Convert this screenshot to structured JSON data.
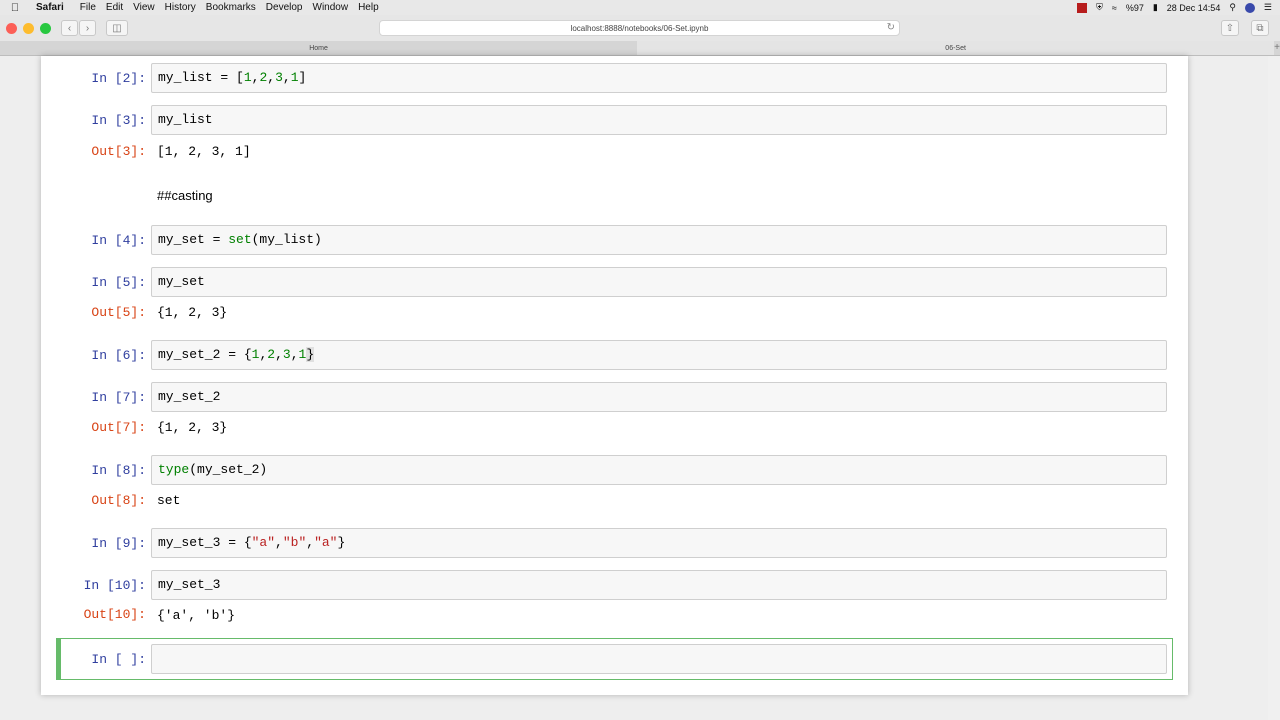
{
  "menubar": {
    "app": "Safari",
    "items": [
      "File",
      "Edit",
      "View",
      "History",
      "Bookmarks",
      "Develop",
      "Window",
      "Help"
    ],
    "battery": "%97",
    "datetime": "28 Dec  14:54"
  },
  "browser": {
    "url": "localhost:8888/notebooks/06-Set.ipynb",
    "tabs": [
      "Home",
      "06-Set"
    ]
  },
  "notebook": {
    "cells": [
      {
        "prompt": "In [2]:",
        "code": "my_list = [1,2,3,1]"
      },
      {
        "prompt": "In [3]:",
        "code": "my_list",
        "out_prompt": "Out[3]:",
        "output": "[1, 2, 3, 1]"
      },
      {
        "markdown": "##casting"
      },
      {
        "prompt": "In [4]:",
        "code": "my_set = set(my_list)"
      },
      {
        "prompt": "In [5]:",
        "code": "my_set",
        "out_prompt": "Out[5]:",
        "output": "{1, 2, 3}"
      },
      {
        "prompt": "In [6]:",
        "code": "my_set_2 = {1,2,3,1}"
      },
      {
        "prompt": "In [7]:",
        "code": "my_set_2",
        "out_prompt": "Out[7]:",
        "output": "{1, 2, 3}"
      },
      {
        "prompt": "In [8]:",
        "code": "type(my_set_2)",
        "out_prompt": "Out[8]:",
        "output": "set"
      },
      {
        "prompt": "In [9]:",
        "code": "my_set_3 = {\"a\",\"b\",\"a\"}"
      },
      {
        "prompt": "In [10]:",
        "code": "my_set_3",
        "out_prompt": "Out[10]:",
        "output": "{'a', 'b'}"
      },
      {
        "prompt": "In [ ]:",
        "code": ""
      }
    ]
  },
  "colors": {
    "in_prompt": "#303f9f",
    "out_prompt": "#d84315",
    "keyword_green": "#008000",
    "selected_cell": "#66bb6a"
  }
}
